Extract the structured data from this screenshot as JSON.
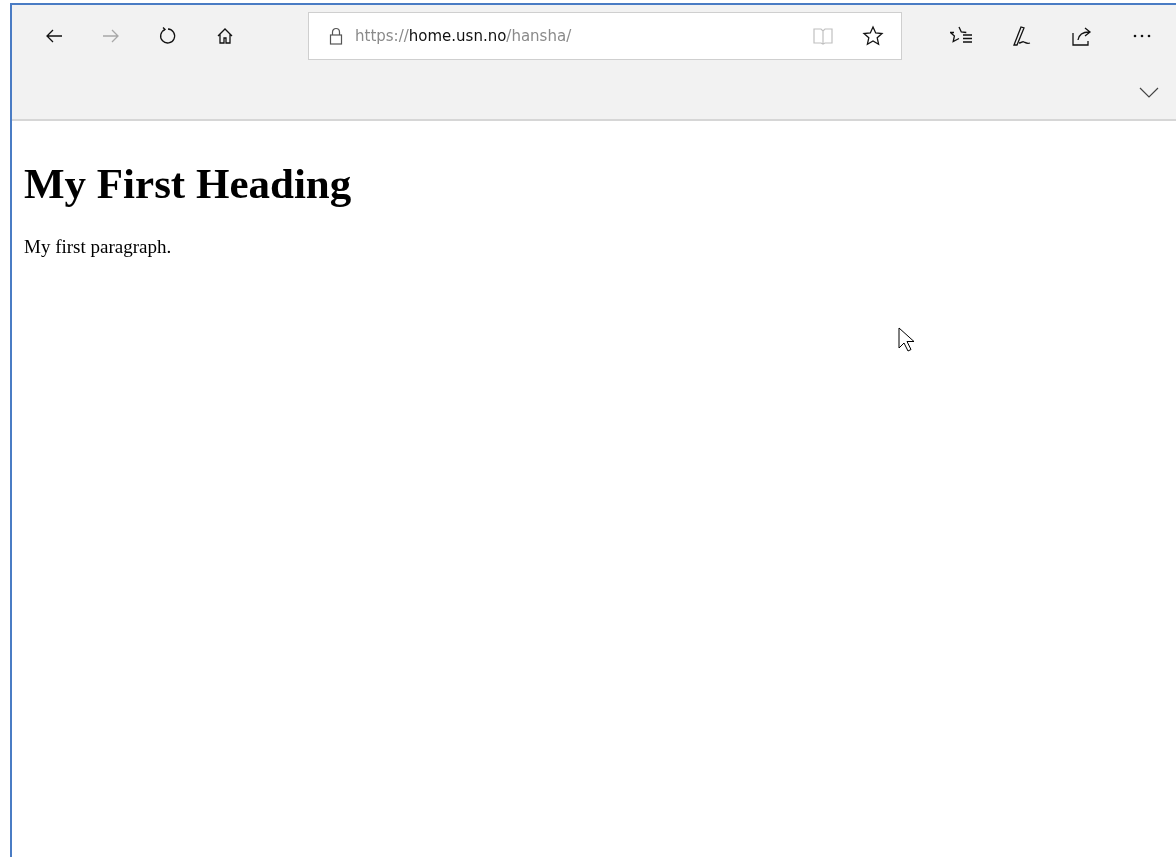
{
  "nav_buttons": [
    {
      "kind": "back",
      "disabled": false
    },
    {
      "kind": "forward",
      "disabled": true
    },
    {
      "kind": "refresh",
      "disabled": false
    },
    {
      "kind": "home",
      "disabled": false
    }
  ],
  "address_bar": {
    "scheme": "https://",
    "host": "home.usn.no",
    "path": "/hansha/",
    "reading_view_disabled": true
  },
  "toolbar_buttons": [
    {
      "kind": "favorites"
    },
    {
      "kind": "notes"
    },
    {
      "kind": "share"
    },
    {
      "kind": "more"
    }
  ],
  "page": {
    "heading": "My First Heading",
    "paragraph": "My first paragraph."
  }
}
